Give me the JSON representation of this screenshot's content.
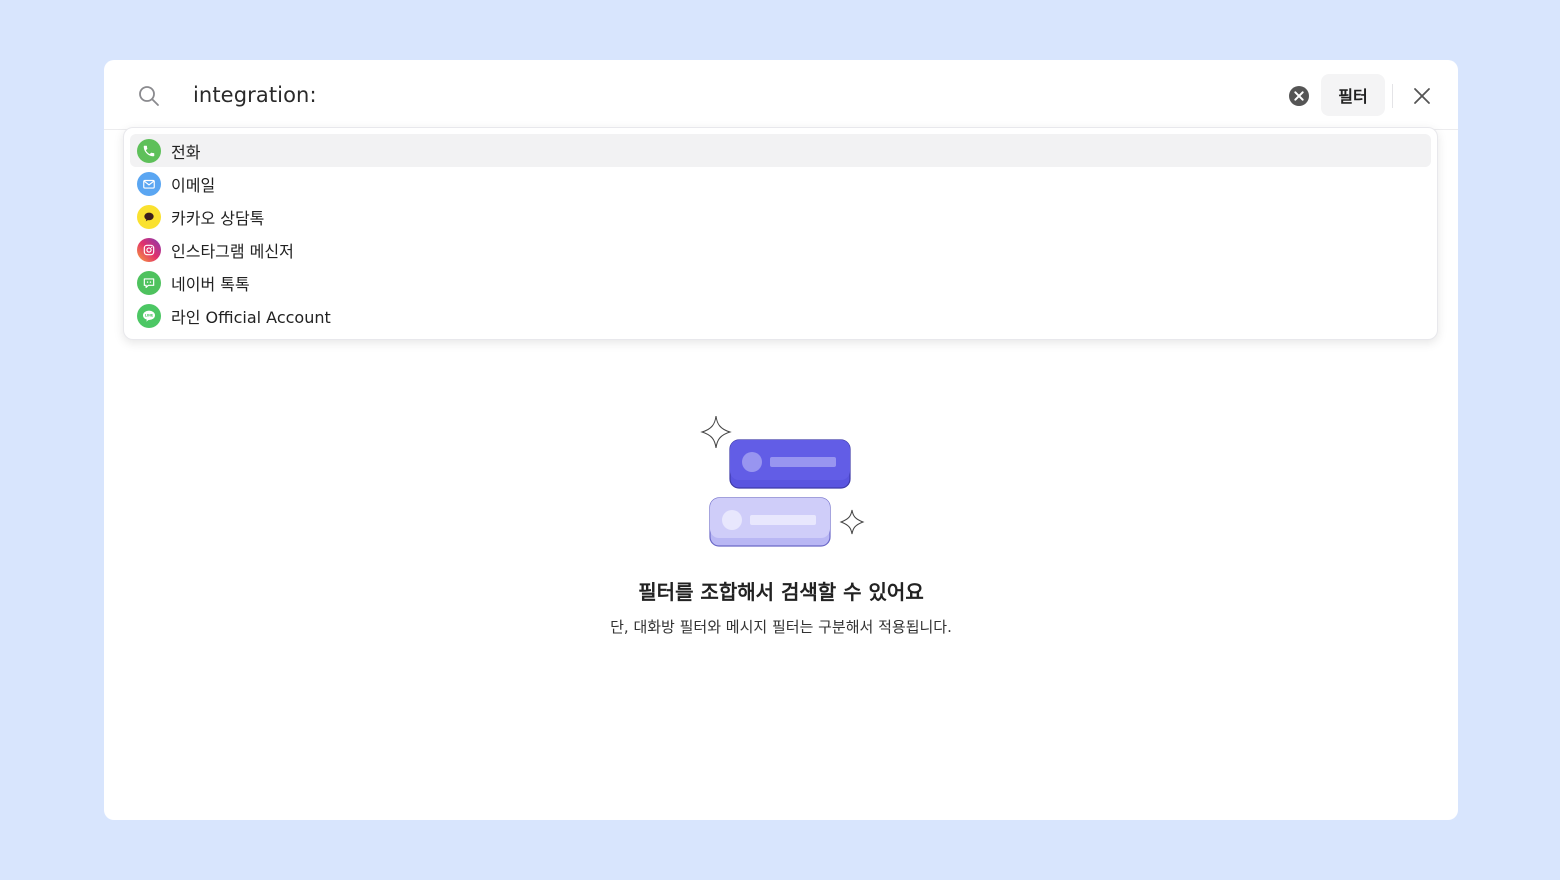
{
  "search": {
    "query": "integration:",
    "filter_label": "필터"
  },
  "suggestions": [
    {
      "label": "전화",
      "icon": "phone-icon",
      "color": "#5ec05a"
    },
    {
      "label": "이메일",
      "icon": "envelope-icon",
      "color": "#5aa6f2"
    },
    {
      "label": "카카오 상담톡",
      "icon": "kakao-chat-icon",
      "color": "#fae12f"
    },
    {
      "label": "인스타그램 메신저",
      "icon": "instagram-icon",
      "color": "#e1306c"
    },
    {
      "label": "네이버 톡톡",
      "icon": "naver-talk-icon",
      "color": "#4ec25e"
    },
    {
      "label": "라인 Official Account",
      "icon": "line-icon",
      "color": "#4cc764"
    }
  ],
  "empty_state": {
    "title": "필터를 조합해서 검색할 수 있어요",
    "subtitle": "단, 대화방 필터와 메시지 필터는 구분해서 적용됩니다."
  },
  "colors": {
    "background": "#d8e5fd",
    "accent": "#5a55e0",
    "accent_light": "#c9c8f8"
  }
}
